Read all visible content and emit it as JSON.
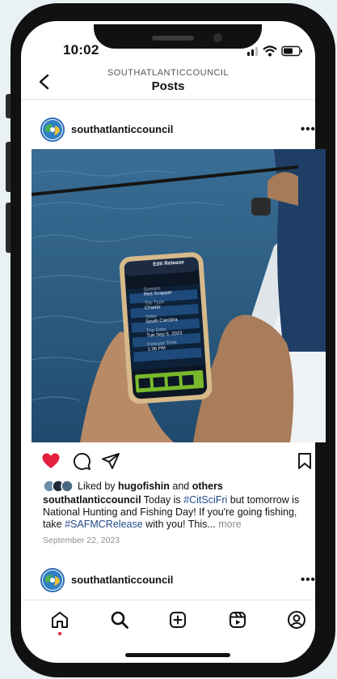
{
  "status": {
    "time": "10:02"
  },
  "header": {
    "account": "SOUTHATLANTICCOUNCIL",
    "title": "Posts"
  },
  "post": {
    "username": "southatlanticcouncil",
    "more_label": "•••",
    "liked_prefix": "Liked by ",
    "liked_user": "hugofishin",
    "liked_middle": " and ",
    "liked_others": "others",
    "caption_user": "southatlanticcouncil",
    "caption_text_1": " Today is ",
    "caption_tag_1": "#CitSciFri",
    "caption_text_2": " but tomorrow is National Hunting and Fishing Day! If you're going fishing, take ",
    "caption_tag_2": "#SAFMCRelease",
    "caption_text_3": " with you! This... ",
    "caption_more": "more",
    "date": "September 22, 2023"
  },
  "phone_app": {
    "title": "Edit Release",
    "fields": [
      {
        "label": "Species",
        "value": "Red Snapper"
      },
      {
        "label": "Trip Type",
        "value": "Charter"
      },
      {
        "label": "State",
        "value": "South Carolina"
      },
      {
        "label": "Trip Date",
        "value": "Tue Sep 5, 2023"
      },
      {
        "label": "Release Time",
        "value": "1:36 PM"
      }
    ]
  },
  "next_post": {
    "username": "southatlanticcouncil",
    "more_label": "•••"
  },
  "colors": {
    "like": "#e3203f",
    "tag": "#1f4a8a",
    "ocean": "#2b5d86",
    "boat": "#e8ecee"
  },
  "icons": {
    "like": "heart-icon",
    "comment": "comment-icon",
    "share": "paper-plane-icon",
    "save": "bookmark-icon",
    "home": "home-icon",
    "search": "search-icon",
    "create": "plus-square-icon",
    "reels": "reels-icon",
    "profile": "profile-icon"
  }
}
